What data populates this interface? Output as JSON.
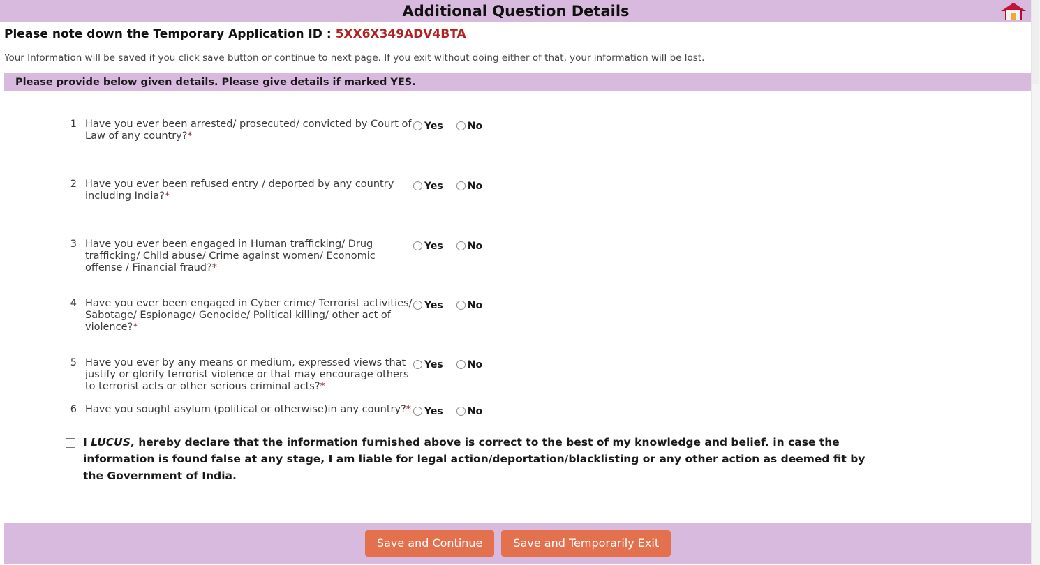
{
  "header": {
    "title": "Additional Question Details",
    "home_icon": "home-icon",
    "band_color": "#d8bade"
  },
  "notice": {
    "app_id_label": "Please note down the Temporary Application ID : ",
    "app_id_value": "5XX6X349ADV4BTA",
    "app_id_color": "#b22222",
    "save_note": "Your Information will be saved if you click save button or continue to next page. If you exit without doing either of that, your information will be lost.",
    "instruction_band": "Please provide below given details. Please give details if marked YES."
  },
  "options": {
    "yes": "Yes",
    "no": "No"
  },
  "questions": [
    {
      "number": "1",
      "text": "Have you ever been arrested/ prosecuted/ convicted by Court of Law of any country?",
      "required_mark": "*",
      "selected": ""
    },
    {
      "number": "2",
      "text": "Have you ever been refused entry / deported by any country including India?",
      "required_mark": "*",
      "selected": ""
    },
    {
      "number": "3",
      "text": "Have you ever been engaged in Human trafficking/ Drug trafficking/ Child abuse/ Crime against women/ Economic offense / Financial fraud?",
      "required_mark": "*",
      "selected": ""
    },
    {
      "number": "4",
      "text": "Have you ever been engaged in Cyber crime/ Terrorist activities/ Sabotage/ Espionage/ Genocide/ Political killing/ other act of violence?",
      "required_mark": "*",
      "selected": ""
    },
    {
      "number": "5",
      "text": "Have you ever by any means or medium, expressed views that justify or glorify terrorist violence or that may encourage others to terrorist acts or other serious criminal acts?",
      "required_mark": "*",
      "selected": ""
    },
    {
      "number": "6",
      "text": "Have you sought asylum (political or otherwise)in any country?",
      "required_mark": "*",
      "selected": ""
    }
  ],
  "declaration": {
    "checked": false,
    "prefix": "I ",
    "name": "LUCUS",
    "body": ", hereby declare that the information furnished above is correct to the best of my knowledge and belief. in case the information is found false at any stage, I am liable for legal action/deportation/blacklisting or any other action as deemed fit by the Government of India."
  },
  "footer": {
    "save_continue_label": "Save and Continue",
    "save_exit_label": "Save and Temporarily Exit",
    "button_color": "#e4714e",
    "band_color": "#d8bade"
  }
}
